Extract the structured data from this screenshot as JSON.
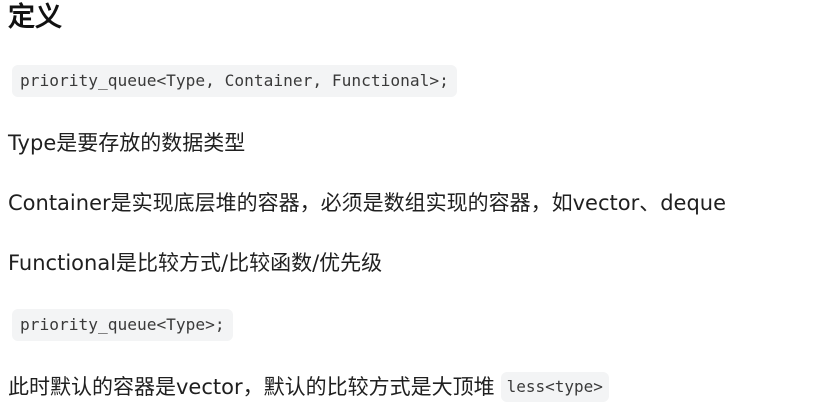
{
  "heading": "定义",
  "code_full": "priority_queue<Type, Container, Functional>;",
  "type_desc": "Type是要存放的数据类型",
  "container_desc": "Container是实现底层堆的容器，必须是数组实现的容器，如vector、deque",
  "functional_desc": "Functional是比较方式/比较函数/优先级",
  "code_short": "priority_queue<Type>;",
  "default_desc": "此时默认的容器是vector，默认的比较方式是大顶堆",
  "default_code": "less<type>"
}
